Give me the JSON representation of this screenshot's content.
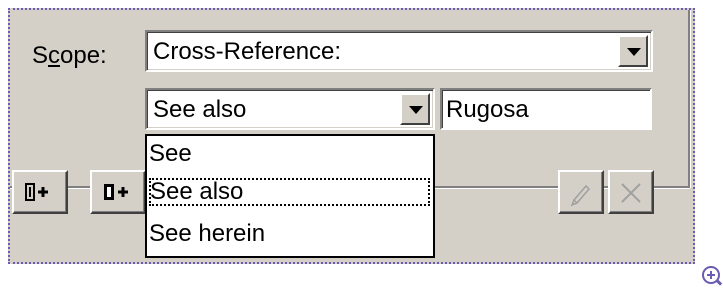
{
  "scope": {
    "label_prefix": "S",
    "label_mnemonic": "c",
    "label_suffix": "ope:",
    "value": "Cross-Reference:"
  },
  "xref": {
    "type_value": "See also",
    "target_value": "Rugosa",
    "options": [
      "See",
      "See also",
      "See herein"
    ],
    "focused_option": "See also"
  },
  "toolbar": {
    "add_left_icon": "insert-before-icon",
    "add_right_icon": "insert-after-icon",
    "edit_icon": "pencil-icon",
    "delete_icon": "delete-x-icon"
  },
  "colors": {
    "dialog_bg": "#d4d0c8",
    "crop_border": "#6a5bb3"
  }
}
